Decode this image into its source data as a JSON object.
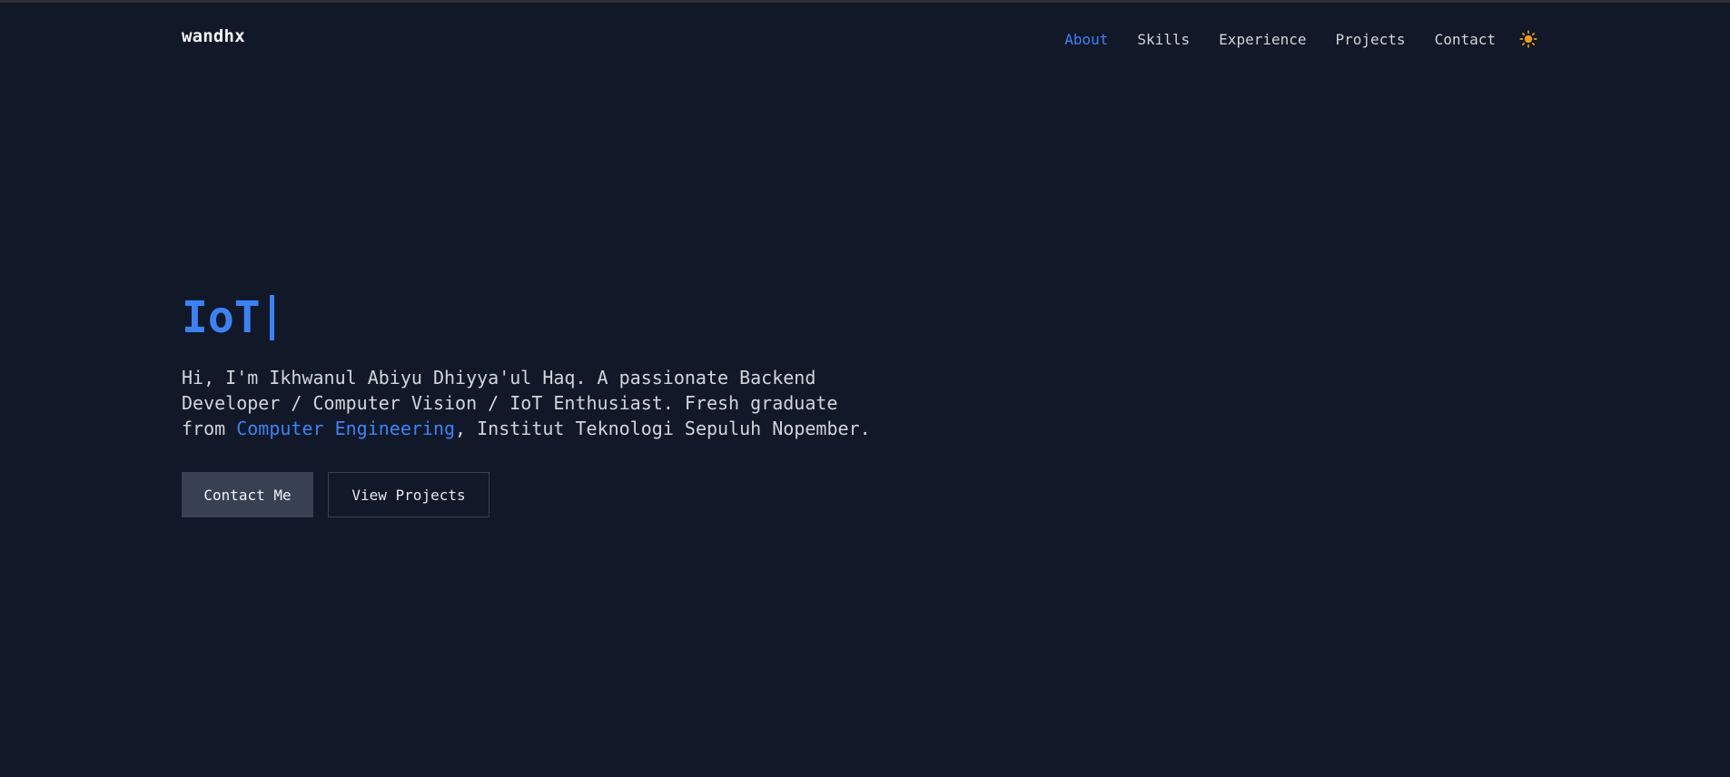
{
  "brand": "wandhx",
  "nav": {
    "items": [
      {
        "label": "About",
        "active": true
      },
      {
        "label": "Skills",
        "active": false
      },
      {
        "label": "Experience",
        "active": false
      },
      {
        "label": "Projects",
        "active": false
      },
      {
        "label": "Contact",
        "active": false
      }
    ],
    "theme_icon": "sun-icon"
  },
  "hero": {
    "title": "IoT",
    "intro_part1": "Hi, I'm Ikhwanul Abiyu Dhiyya'ul Haq. A passionate Backend Developer / Computer Vision / IoT Enthusiast. Fresh graduate from ",
    "intro_link": "Computer Engineering",
    "intro_part2": ", Institut Teknologi Sepuluh Nopember.",
    "buttons": {
      "primary": "Contact Me",
      "secondary": "View Projects"
    }
  },
  "colors": {
    "background": "#111827",
    "accent": "#3b82f6",
    "text": "#d1d5db",
    "sun": "#f59e0b"
  }
}
